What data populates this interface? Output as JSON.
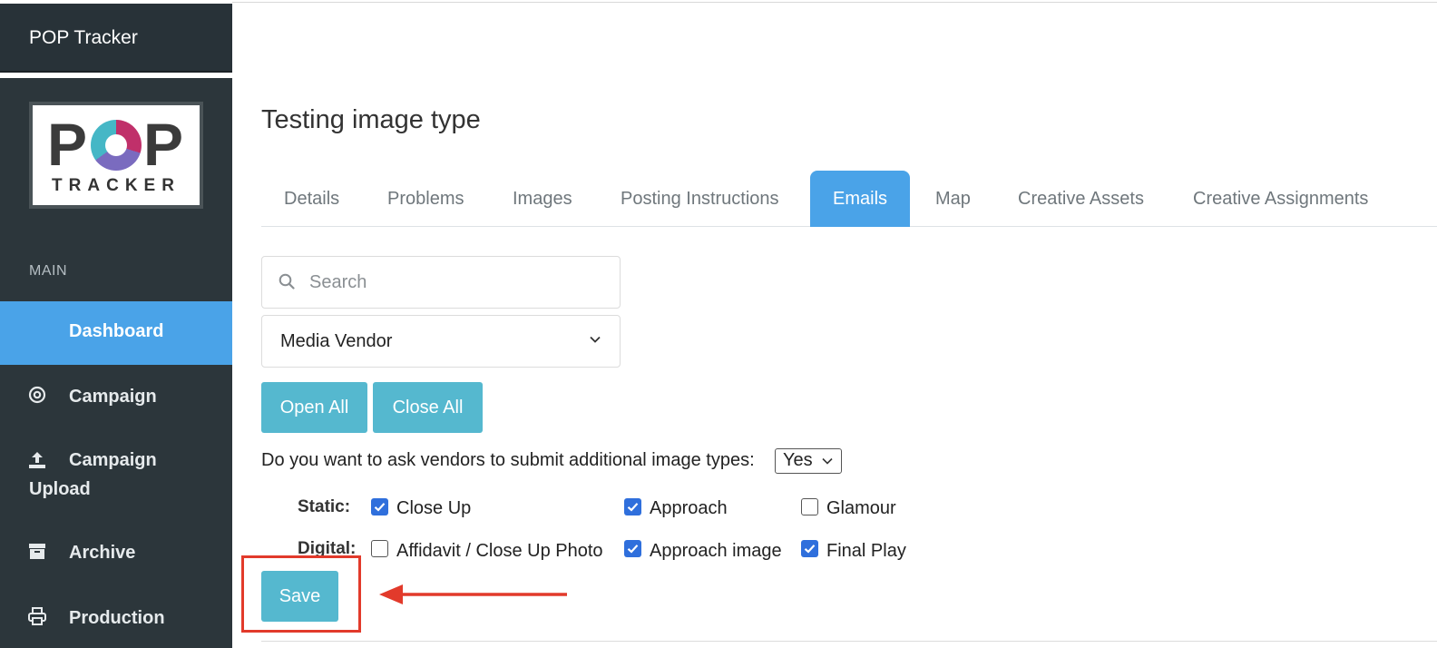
{
  "app": {
    "title": "POP Tracker"
  },
  "logo": {
    "text_top": "POP",
    "text_bottom": "TRACKER"
  },
  "sidebar": {
    "section": "MAIN",
    "items": [
      {
        "label": "Dashboard",
        "icon": "none",
        "active": true
      },
      {
        "label": "Campaign",
        "icon": "target-icon"
      },
      {
        "label": "Campaign",
        "label2": "Upload",
        "icon": "upload-icon"
      },
      {
        "label": "Archive",
        "icon": "archive-icon"
      },
      {
        "label": "Production",
        "icon": "printer-icon"
      }
    ]
  },
  "page": {
    "title": "Testing image type"
  },
  "tabs": [
    {
      "label": "Details"
    },
    {
      "label": "Problems"
    },
    {
      "label": "Images"
    },
    {
      "label": "Posting Instructions"
    },
    {
      "label": "Emails",
      "active": true
    },
    {
      "label": "Map"
    },
    {
      "label": "Creative Assets"
    },
    {
      "label": "Creative Assignments"
    }
  ],
  "search": {
    "placeholder": "Search"
  },
  "vendor_select": {
    "value": "Media Vendor"
  },
  "buttons": {
    "open_all": "Open All",
    "close_all": "Close All",
    "save": "Save"
  },
  "question": {
    "text": "Do you want to ask vendors to submit additional image types:",
    "answer": "Yes"
  },
  "image_types": {
    "static_label": "Static:",
    "digital_label": "Digital:",
    "static": [
      {
        "label": "Close Up",
        "checked": true
      },
      {
        "label": "Approach",
        "checked": true
      },
      {
        "label": "Glamour",
        "checked": false
      }
    ],
    "digital": [
      {
        "label": "Affidavit / Close Up Photo",
        "checked": false
      },
      {
        "label": "Approach image",
        "checked": true
      },
      {
        "label": "Final Play",
        "checked": true
      }
    ]
  },
  "colors": {
    "sidebar": "#2c363b",
    "accent": "#4aa3e8",
    "button": "#55b8cf",
    "annotation": "#e23a2b"
  }
}
